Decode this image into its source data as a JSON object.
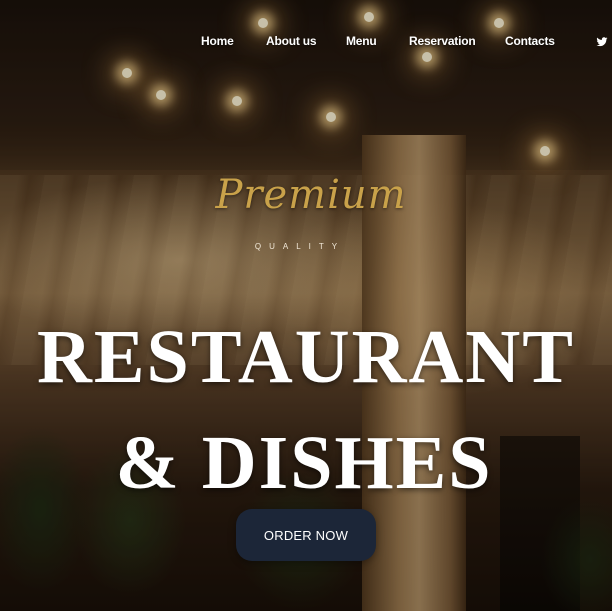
{
  "nav": {
    "items": [
      "Home",
      "About us",
      "Menu",
      "Reservation",
      "Contacts"
    ],
    "social_icon": "twitter-icon"
  },
  "hero": {
    "script_title": "Premium",
    "tagline": "QUALITY",
    "title_line1": "Restaurant",
    "title_line2": "& Dishes",
    "cta_label": "ORDER NOW"
  },
  "colors": {
    "script_gold": "#c9a24a",
    "button_bg": "#1c2638",
    "text_white": "#ffffff"
  }
}
